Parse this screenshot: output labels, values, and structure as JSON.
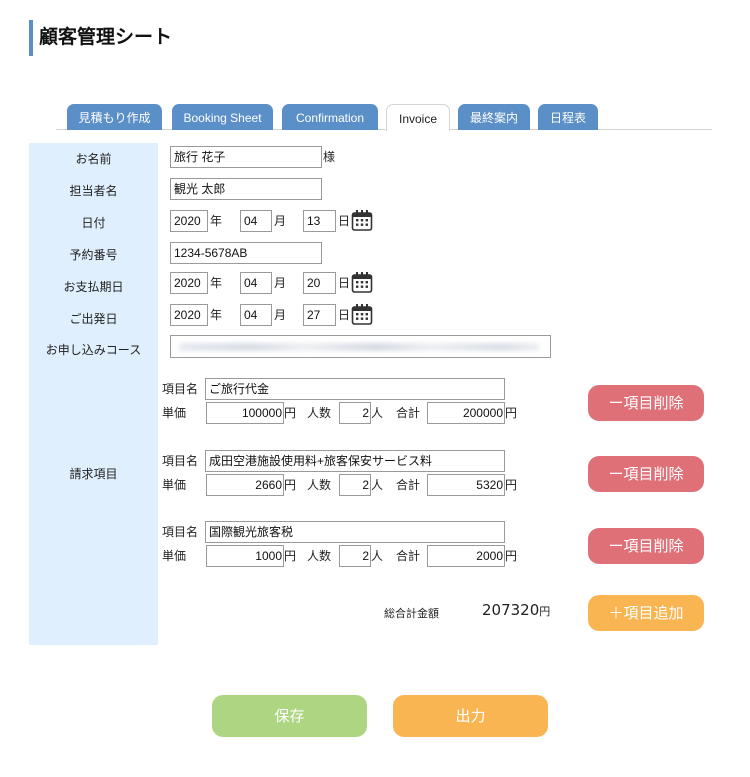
{
  "header": {
    "title": "顧客管理シート"
  },
  "tabs": [
    {
      "label": "見積もり作成",
      "active": false
    },
    {
      "label": "Booking Sheet",
      "active": false
    },
    {
      "label": "Confirmation",
      "active": false
    },
    {
      "label": "Invoice",
      "active": true
    },
    {
      "label": "最終案内",
      "active": false
    },
    {
      "label": "日程表",
      "active": false
    }
  ],
  "form": {
    "customer_name": {
      "label": "お名前",
      "value": "旅行 花子",
      "suffix": "様"
    },
    "staff_name": {
      "label": "担当者名",
      "value": "観光 太郎"
    },
    "date": {
      "label": "日付",
      "year": "2020",
      "month": "04",
      "day": "13"
    },
    "booking_number": {
      "label": "予約番号",
      "value": "1234-5678AB"
    },
    "payment_due": {
      "label": "お支払期日",
      "year": "2020",
      "month": "04",
      "day": "20"
    },
    "departure": {
      "label": "ご出発日",
      "year": "2020",
      "month": "04",
      "day": "27"
    },
    "course": {
      "label": "お申し込みコース",
      "value": ""
    },
    "units": {
      "year": "年",
      "month": "月",
      "day": "日"
    }
  },
  "billing": {
    "label": "請求項目",
    "field_labels": {
      "item_name": "項目名",
      "unit_price": "単価",
      "yen": "円",
      "pax": "人数",
      "person": "人",
      "subtotal": "合計"
    },
    "items": [
      {
        "name": "ご旅行代金",
        "unit_price": "100000",
        "pax": "2",
        "subtotal": "200000"
      },
      {
        "name": "成田空港施設使用料+旅客保安サービス料",
        "unit_price": "2660",
        "pax": "2",
        "subtotal": "5320"
      },
      {
        "name": "国際観光旅客税",
        "unit_price": "1000",
        "pax": "2",
        "subtotal": "2000"
      }
    ],
    "delete_label": "ー項目削除",
    "add_label": "＋項目追加",
    "grand_total_label": "総合計金額",
    "grand_total_value": "207320",
    "grand_total_unit": "円"
  },
  "actions": {
    "save_label": "保存",
    "output_label": "出力"
  }
}
